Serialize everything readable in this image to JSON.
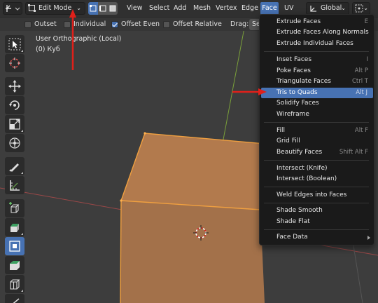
{
  "header": {
    "mode": "Edit Mode",
    "menus": [
      "View",
      "Select",
      "Add",
      "Mesh",
      "Vertex",
      "Edge",
      "Face",
      "UV"
    ],
    "active_menu": "Face",
    "orientation": "Global"
  },
  "tool_settings": {
    "outset": {
      "label": "Outset",
      "checked": false
    },
    "individual": {
      "label": "Individual",
      "checked": false
    },
    "offset_even": {
      "label": "Offset Even",
      "checked": true
    },
    "offset_relative": {
      "label": "Offset Relative",
      "checked": false
    },
    "drag_label": "Drag:",
    "drag_value": "Se"
  },
  "viewport": {
    "view_name": "User Orthographic (Local)",
    "object_name": "(0) Куб"
  },
  "face_menu": {
    "items": [
      {
        "label": "Extrude Faces",
        "shortcut": "E"
      },
      {
        "label": "Extrude Faces Along Normals",
        "shortcut": ""
      },
      {
        "label": "Extrude Individual Faces",
        "shortcut": ""
      },
      {
        "label": "Inset Faces",
        "shortcut": "I"
      },
      {
        "label": "Poke Faces",
        "shortcut": "Alt P"
      },
      {
        "label": "Triangulate Faces",
        "shortcut": "Ctrl T"
      },
      {
        "label": "Tris to Quads",
        "shortcut": "Alt J"
      },
      {
        "label": "Solidify Faces",
        "shortcut": ""
      },
      {
        "label": "Wireframe",
        "shortcut": ""
      },
      {
        "label": "Fill",
        "shortcut": "Alt F"
      },
      {
        "label": "Grid Fill",
        "shortcut": ""
      },
      {
        "label": "Beautify Faces",
        "shortcut": "Shift Alt F"
      },
      {
        "label": "Intersect (Knife)",
        "shortcut": ""
      },
      {
        "label": "Intersect (Boolean)",
        "shortcut": ""
      },
      {
        "label": "Weld Edges into Faces",
        "shortcut": ""
      },
      {
        "label": "Shade Smooth",
        "shortcut": ""
      },
      {
        "label": "Shade Flat",
        "shortcut": ""
      },
      {
        "label": "Face Data",
        "shortcut": ""
      }
    ],
    "highlighted": "Tris to Quads"
  },
  "colors": {
    "accent": "#4772b3",
    "annotation_arrow": "#e0201a",
    "mesh_face": "#a0714a",
    "mesh_edge": "#f5a040",
    "axis_x": "#a04646",
    "axis_y": "#7aa03a"
  }
}
